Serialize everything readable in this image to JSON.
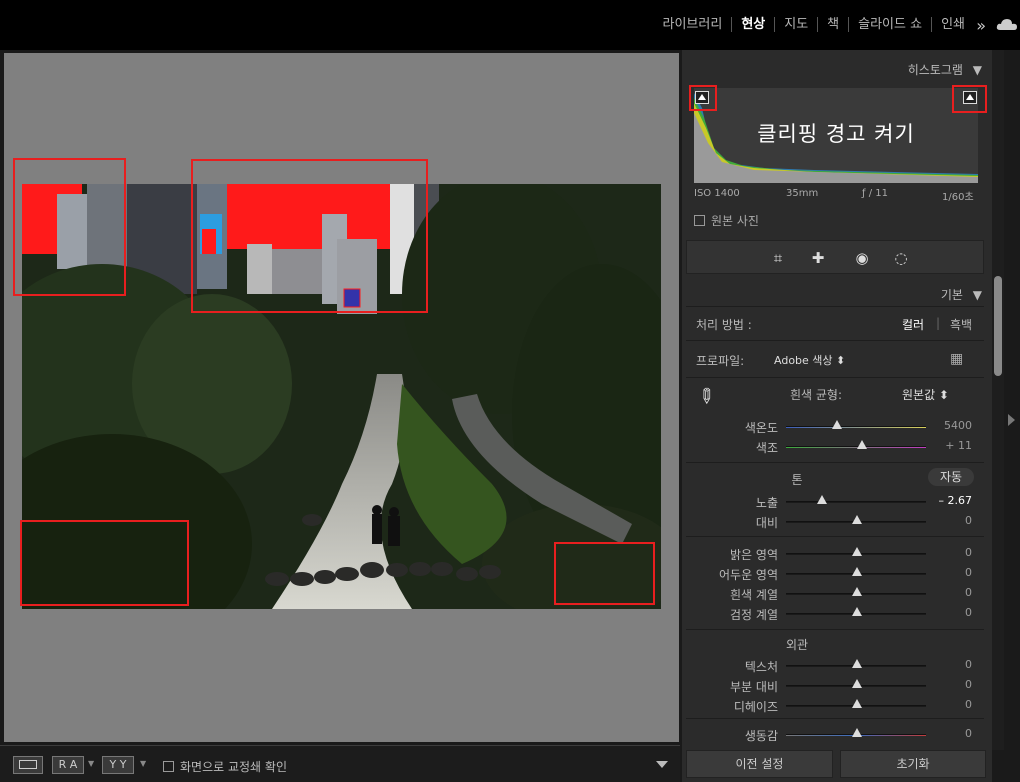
{
  "modules": [
    "라이브러리",
    "현상",
    "지도",
    "책",
    "슬라이드 쇼",
    "인쇄"
  ],
  "active_module": "현상",
  "histogram": {
    "title": "히스토그램",
    "tooltip": "클리핑 경고 켜기",
    "iso": "ISO 1400",
    "focal": "35mm",
    "aperture": "ƒ / 11",
    "shutter": "1/60초",
    "original_photo": "원본 사진"
  },
  "basic": {
    "title": "기본",
    "treatment_label": "처리 방법 :",
    "treatment_color": "컬러",
    "treatment_bw": "흑백",
    "profile_label": "프로파일:",
    "profile_value": "Adobe 색상 ⬍",
    "wb_label": "흰색 균형:",
    "wb_value": "원본값 ⬍",
    "tone_label": "톤",
    "auto_label": "자동",
    "presence_label": "외관"
  },
  "sliders": {
    "temp": {
      "label": "색온도",
      "value": "5400"
    },
    "tint": {
      "label": "색조",
      "value": "+ 11"
    },
    "exposure": {
      "label": "노출",
      "value": "– 2.67"
    },
    "contrast": {
      "label": "대비",
      "value": "0"
    },
    "highlights": {
      "label": "밝은 영역",
      "value": "0"
    },
    "shadows": {
      "label": "어두운 영역",
      "value": "0"
    },
    "whites": {
      "label": "흰색 계열",
      "value": "0"
    },
    "blacks": {
      "label": "검정 계열",
      "value": "0"
    },
    "texture": {
      "label": "텍스처",
      "value": "0"
    },
    "clarity": {
      "label": "부분 대비",
      "value": "0"
    },
    "dehaze": {
      "label": "디헤이즈",
      "value": "0"
    },
    "vibrance": {
      "label": "생동감",
      "value": "0"
    }
  },
  "toolbar": {
    "ra": "R A",
    "yy": "Y Y",
    "softproof": "화면으로 교정쇄 확인"
  },
  "buttons": {
    "previous": "이전 설정",
    "reset": "초기화"
  }
}
